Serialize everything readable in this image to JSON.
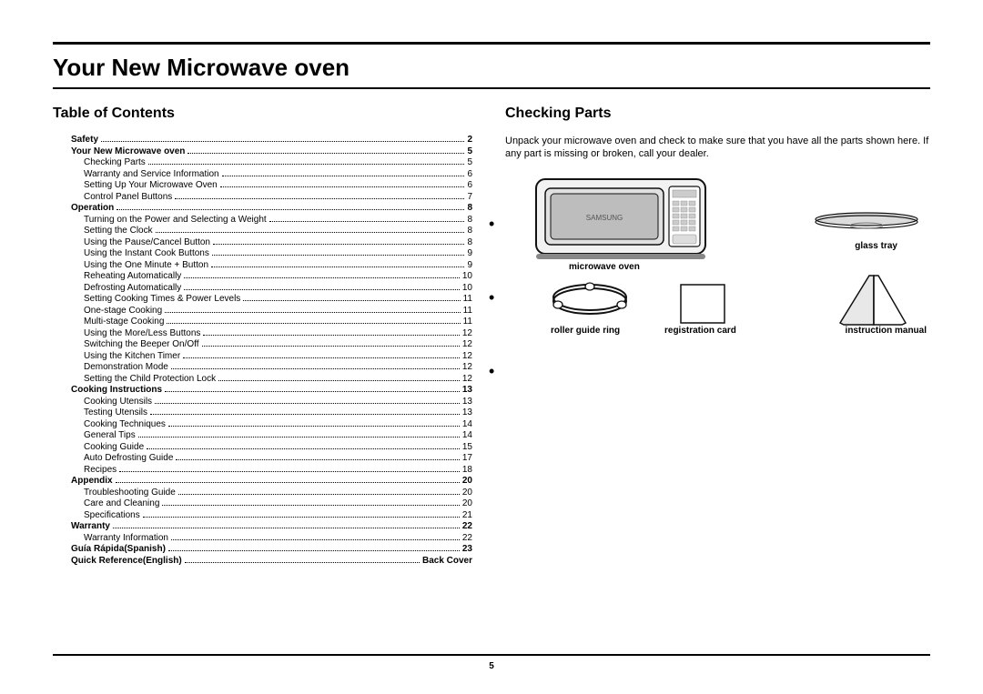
{
  "page_title": "Your New Microwave oven",
  "toc_heading": "Table of Contents",
  "checking_heading": "Checking Parts",
  "checking_intro": "Unpack your microwave oven and check to make sure that you have all the parts shown here. If any part is missing or broken, call your dealer.",
  "page_number": "5",
  "parts": {
    "microwave": "microwave oven",
    "glass_tray": "glass tray",
    "roller": "roller guide ring",
    "reg_card": "registration card",
    "manual": "instruction manual"
  },
  "toc": [
    {
      "label": "Safety",
      "page": "2",
      "bold": true,
      "sub": false
    },
    {
      "label": "Your New Microwave oven",
      "page": "5",
      "bold": true,
      "sub": false
    },
    {
      "label": "Checking Parts",
      "page": "5",
      "bold": false,
      "sub": true
    },
    {
      "label": "Warranty and Service Information",
      "page": "6",
      "bold": false,
      "sub": true
    },
    {
      "label": "Setting Up Your Microwave Oven",
      "page": "6",
      "bold": false,
      "sub": true
    },
    {
      "label": "Control Panel Buttons",
      "page": "7",
      "bold": false,
      "sub": true
    },
    {
      "label": "Operation",
      "page": "8",
      "bold": true,
      "sub": false
    },
    {
      "label": "Turning on the Power and Selecting a Weight",
      "page": "8",
      "bold": false,
      "sub": true
    },
    {
      "label": "Setting the Clock",
      "page": "8",
      "bold": false,
      "sub": true
    },
    {
      "label": "Using the Pause/Cancel Button",
      "page": "8",
      "bold": false,
      "sub": true
    },
    {
      "label": "Using the Instant Cook Buttons",
      "page": "9",
      "bold": false,
      "sub": true
    },
    {
      "label": "Using the One Minute + Button",
      "page": "9",
      "bold": false,
      "sub": true
    },
    {
      "label": "Reheating Automatically",
      "page": "10",
      "bold": false,
      "sub": true
    },
    {
      "label": "Defrosting Automatically",
      "page": "10",
      "bold": false,
      "sub": true
    },
    {
      "label": "Setting Cooking Times & Power Levels",
      "page": "11",
      "bold": false,
      "sub": true
    },
    {
      "label": "One-stage Cooking",
      "page": "11",
      "bold": false,
      "sub": true
    },
    {
      "label": "Multi-stage Cooking",
      "page": "11",
      "bold": false,
      "sub": true
    },
    {
      "label": "Using the More/Less Buttons",
      "page": "12",
      "bold": false,
      "sub": true
    },
    {
      "label": "Switching the Beeper On/Off",
      "page": "12",
      "bold": false,
      "sub": true
    },
    {
      "label": "Using the Kitchen Timer",
      "page": "12",
      "bold": false,
      "sub": true
    },
    {
      "label": "Demonstration Mode",
      "page": "12",
      "bold": false,
      "sub": true
    },
    {
      "label": "Setting the Child Protection Lock",
      "page": "12",
      "bold": false,
      "sub": true
    },
    {
      "label": "Cooking Instructions",
      "page": "13",
      "bold": true,
      "sub": false
    },
    {
      "label": "Cooking Utensils",
      "page": "13",
      "bold": false,
      "sub": true
    },
    {
      "label": "Testing Utensils",
      "page": "13",
      "bold": false,
      "sub": true
    },
    {
      "label": "Cooking Techniques",
      "page": "14",
      "bold": false,
      "sub": true
    },
    {
      "label": "General Tips",
      "page": "14",
      "bold": false,
      "sub": true
    },
    {
      "label": "Cooking Guide",
      "page": "15",
      "bold": false,
      "sub": true
    },
    {
      "label": "Auto Defrosting Guide",
      "page": "17",
      "bold": false,
      "sub": true
    },
    {
      "label": "Recipes",
      "page": "18",
      "bold": false,
      "sub": true
    },
    {
      "label": "Appendix",
      "page": "20",
      "bold": true,
      "sub": false
    },
    {
      "label": "Troubleshooting Guide",
      "page": "20",
      "bold": false,
      "sub": true
    },
    {
      "label": "Care and Cleaning",
      "page": "20",
      "bold": false,
      "sub": true
    },
    {
      "label": "Specifications",
      "page": "21",
      "bold": false,
      "sub": true
    },
    {
      "label": "Warranty",
      "page": "22",
      "bold": true,
      "sub": false
    },
    {
      "label": "Warranty Information",
      "page": "22",
      "bold": false,
      "sub": true
    },
    {
      "label": "Guía Rápida(Spanish)",
      "page": "23",
      "bold": true,
      "sub": false
    },
    {
      "label": "Quick Reference(English)",
      "page": "Back Cover",
      "bold": true,
      "sub": false
    }
  ]
}
